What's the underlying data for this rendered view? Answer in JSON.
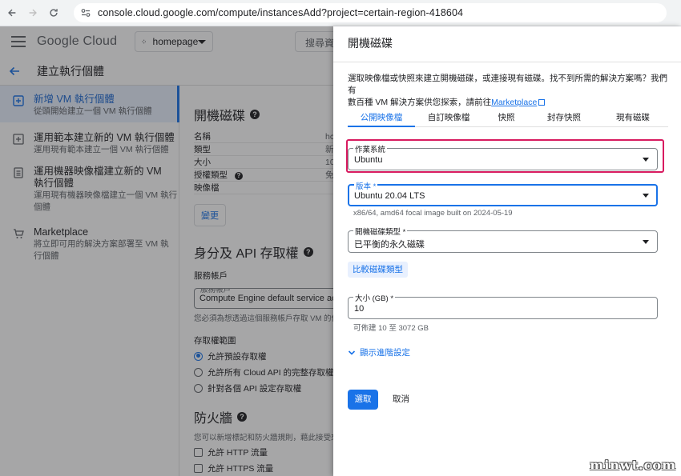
{
  "browser": {
    "url": "console.cloud.google.com/compute/instancesAdd?project=certain-region-418604"
  },
  "app": {
    "logo_google": "Google",
    "logo_cloud": " Cloud",
    "project": "homepage",
    "search_placeholder": "搜尋資",
    "page_title": "建立執行個體"
  },
  "nav": {
    "items": [
      {
        "title": "新增 VM 執行個體",
        "subtitle": "從頭開始建立一個 VM 執行個體"
      },
      {
        "title": "運用範本建立新的 VM 執行個體",
        "subtitle": "運用現有範本建立一個 VM 執行個體"
      },
      {
        "title": "運用機器映像檔建立新的 VM 執行個體",
        "subtitle": "運用現有機器映像檔建立一個 VM 執行個體"
      },
      {
        "title": "Marketplace",
        "subtitle": "將立即可用的解決方案部署至 VM 執行個體"
      }
    ]
  },
  "main": {
    "boot_disk_heading": "開機磁碟",
    "boot_disk_rows": [
      {
        "k": "名稱",
        "v": "hc"
      },
      {
        "k": "類型",
        "v": "新"
      },
      {
        "k": "大小",
        "v": "10"
      },
      {
        "k": "授權類型",
        "v": "免"
      },
      {
        "k": "映像檔",
        "v": ""
      }
    ],
    "change_label": "變更",
    "identity_heading": "身分及 API 存取權",
    "service_account_title": "服務帳戶",
    "service_account_label": "服務帳戶",
    "service_account_value": "Compute Engine default service account",
    "service_account_hint": "您必須為想透過這個服務帳戶存取 VM 的使用者授予角色",
    "scope_title": "存取權範圍",
    "scope_options": [
      "允許預設存取權",
      "允許所有 Cloud API 的完整存取權",
      "針對各個 API 設定存取權"
    ],
    "firewall_heading": "防火牆",
    "firewall_desc": "您可以新增標記和防火牆規則，藉此接受來自網際網路",
    "firewall_options": [
      "允許 HTTP 流量",
      "允許 HTTPS 流量"
    ]
  },
  "panel": {
    "title": "開機磁碟",
    "desc_line1": "選取映像檔或快照來建立開機磁碟，或連接現有磁碟。找不到所需的解決方案嗎？我們有",
    "desc_line2": "數百種 VM 解決方案供您探索，請前往",
    "desc_link": "Marketplace",
    "tabs": [
      "公開映像檔",
      "自訂映像檔",
      "快照",
      "封存快照",
      "現有磁碟"
    ],
    "os_label": "作業系統",
    "os_value": "Ubuntu",
    "version_label": "版本 *",
    "version_value": "Ubuntu 20.04 LTS",
    "version_hint": "x86/64, amd64 focal image built on 2024-05-19",
    "disk_type_label": "開機磁碟類型 *",
    "disk_type_value": "已平衡的永久磁碟",
    "compare_label": "比較磁碟類型",
    "size_label": "大小 (GB) *",
    "size_value": "10",
    "size_hint": "可佈建 10 至 3072 GB",
    "advanced_label": "顯示進階設定",
    "select_label": "選取",
    "cancel_label": "取消"
  },
  "watermark": "minwt.com",
  "colors": {
    "accent": "#1a73e8",
    "highlight": "#d81b60"
  }
}
